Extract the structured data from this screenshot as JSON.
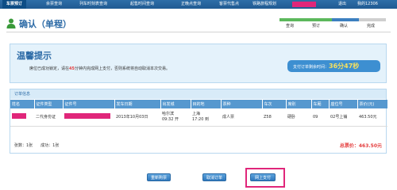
{
  "topnav": {
    "tabs": [
      "车票预订",
      "余票查询",
      "列车时刻表查询",
      "起售时间查询",
      "正晚点查询",
      "客票代售点",
      "铁路旅程规划"
    ],
    "logout": "退出",
    "hotline": "我的12306"
  },
  "page": {
    "title": "确认（单程）",
    "steps": [
      "查询",
      "预订",
      "确认",
      "完成"
    ]
  },
  "tip": {
    "title": "温馨提示",
    "text_before": "席位已成功锁定，请在",
    "minutes": "45",
    "text_after": "分钟内完成网上支付，否则系统将自动取消本次交易。",
    "timer_label": "支付订单剩余时间：",
    "timer_value": "36分47秒"
  },
  "order": {
    "section_title": "订单信息",
    "columns": [
      "姓名",
      "证件类型",
      "证件号",
      "发车日期",
      "出发城",
      "目的地",
      "票种",
      "车次",
      "席别",
      "车厢",
      "座位号",
      "票价(元)"
    ],
    "row": {
      "id_type": "二代身份证",
      "date": "2013年10月03日",
      "from_city": "哈尔滨",
      "from_time": "09:32 开",
      "to_city": "上海",
      "to_time": "17:20 到",
      "ticket_type": "成人票",
      "train": "Z58",
      "seat_class": "硬卧",
      "car": "09",
      "seat": "02号上铺",
      "price": "463.50元"
    },
    "summary_left": "张数：1张　　成功：1张",
    "total": "总票价：463.50元"
  },
  "buttons": {
    "reselect": "重新购票",
    "cancel": "取消订单",
    "pay": "网上支付"
  }
}
